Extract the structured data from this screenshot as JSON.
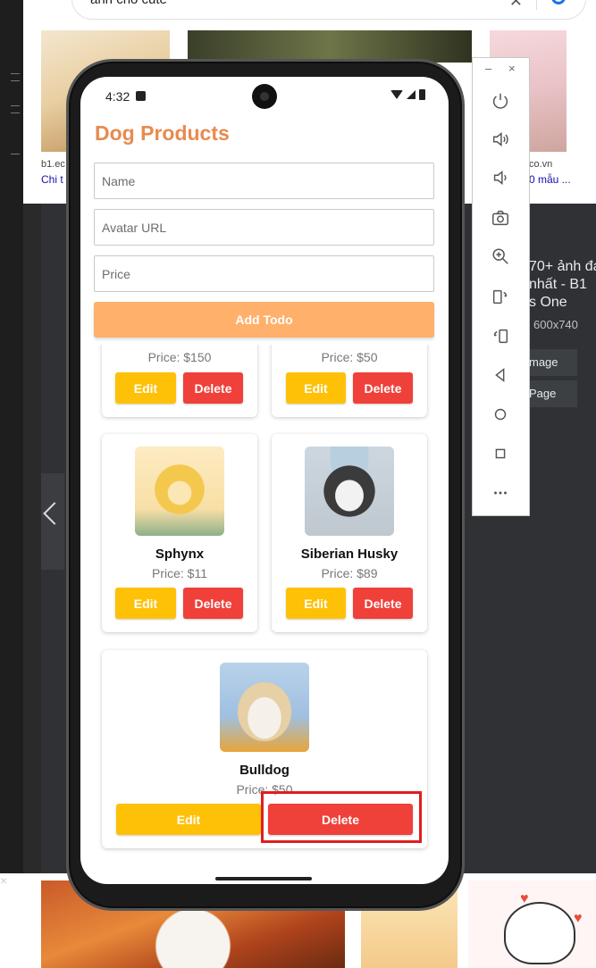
{
  "browser": {
    "search_query": "ảnh chó cute",
    "captions": {
      "left_source": "b1.ec",
      "left_title": "Chi t",
      "right_source": "co.vn",
      "right_title": "0 mẫu ..."
    },
    "side_panel": {
      "title_line1": "70+ ảnh đạ",
      "title_line2": "nhất - B1",
      "title_line3": "s One",
      "dimensions": "600x740",
      "btn_image": "mage",
      "btn_page": "Page"
    },
    "close_glyph": "×"
  },
  "emulator": {
    "minimize": "–",
    "close": "×",
    "tools": [
      "power-icon",
      "volume-up-icon",
      "volume-down-icon",
      "camera-icon",
      "zoom-icon",
      "rotate-left-icon",
      "rotate-right-icon",
      "back-icon",
      "home-icon",
      "overview-icon",
      "more-icon"
    ]
  },
  "phone": {
    "status": {
      "time": "4:32"
    },
    "app": {
      "title": "Dog Products",
      "name_placeholder": "Name",
      "avatar_placeholder": "Avatar URL",
      "price_placeholder": "Price",
      "add_button": "Add Todo",
      "edit_label": "Edit",
      "delete_label": "Delete",
      "products": [
        {
          "name": "",
          "price": "Price: $150"
        },
        {
          "name": "",
          "price": "Price: $50"
        },
        {
          "name": "Sphynx",
          "price": "Price: $11"
        },
        {
          "name": "Siberian Husky",
          "price": "Price: $89"
        },
        {
          "name": "Bulldog",
          "price": "Price: $50"
        }
      ]
    }
  },
  "colors": {
    "title": "#e88a4f",
    "add_button": "#ffb06a",
    "edit": "#ffc107",
    "delete": "#f0403a",
    "highlight": "#e01e1e"
  }
}
